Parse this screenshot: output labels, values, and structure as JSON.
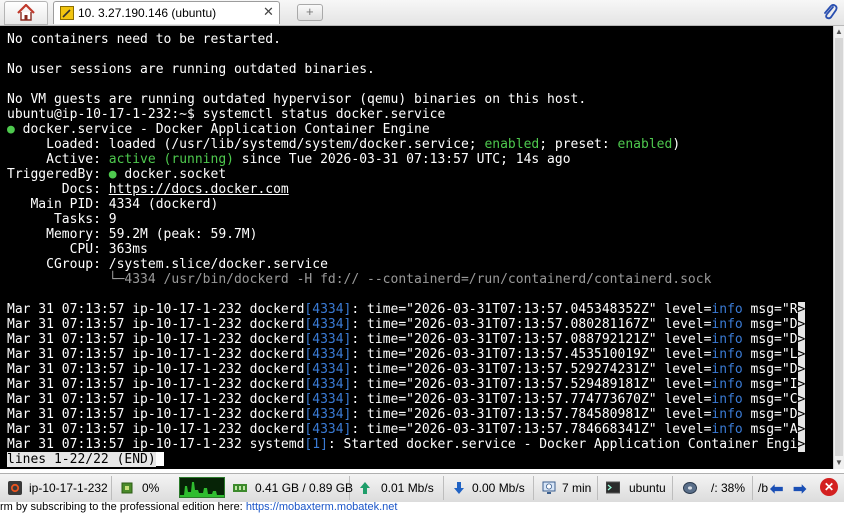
{
  "tabs": {
    "home_icon": "home-icon",
    "session_title": "10. 3.27.190.146 (ubuntu)",
    "close_glyph": "✕",
    "new_tab_glyph": "+"
  },
  "terminal": {
    "lines": [
      "No containers need to be restarted.",
      "",
      "No user sessions are running outdated binaries.",
      "",
      "No VM guests are running outdated hypervisor (qemu) binaries on this host.",
      "ubuntu@ip-10-17-1-232:~$ systemctl status docker.service",
      "● docker.service - Docker Application Container Engine",
      "     Loaded: loaded (/usr/lib/systemd/system/docker.service; enabled; preset: enabled)",
      "     Active: active (running) since Tue 2026-03-31 07:13:57 UTC; 14s ago",
      "TriggeredBy: ● docker.socket",
      "       Docs: https://docs.docker.com",
      "   Main PID: 4334 (dockerd)",
      "      Tasks: 9",
      "     Memory: 59.2M (peak: 59.7M)",
      "        CPU: 363ms",
      "     CGroup: /system.slice/docker.service",
      "             └─4334 /usr/bin/dockerd -H fd:// --containerd=/run/containerd/containerd.sock",
      ""
    ],
    "log": {
      "prefix": "Mar 31 07:13:57 ip-10-17-1-232 ",
      "entries": [
        {
          "proc": "dockerd",
          "pid": "[4334]",
          "time": "2026-03-31T07:13:57.045348352Z",
          "msg": "R"
        },
        {
          "proc": "dockerd",
          "pid": "[4334]",
          "time": "2026-03-31T07:13:57.080281167Z",
          "msg": "D"
        },
        {
          "proc": "dockerd",
          "pid": "[4334]",
          "time": "2026-03-31T07:13:57.088792121Z",
          "msg": "D"
        },
        {
          "proc": "dockerd",
          "pid": "[4334]",
          "time": "2026-03-31T07:13:57.453510019Z",
          "msg": "L"
        },
        {
          "proc": "dockerd",
          "pid": "[4334]",
          "time": "2026-03-31T07:13:57.529274231Z",
          "msg": "D"
        },
        {
          "proc": "dockerd",
          "pid": "[4334]",
          "time": "2026-03-31T07:13:57.529489181Z",
          "msg": "I"
        },
        {
          "proc": "dockerd",
          "pid": "[4334]",
          "time": "2026-03-31T07:13:57.774773670Z",
          "msg": "C"
        },
        {
          "proc": "dockerd",
          "pid": "[4334]",
          "time": "2026-03-31T07:13:57.784580981Z",
          "msg": "D"
        },
        {
          "proc": "dockerd",
          "pid": "[4334]",
          "time": "2026-03-31T07:13:57.784668341Z",
          "msg": "A"
        }
      ],
      "last_line": {
        "proc": "systemd",
        "pid": "[1]",
        "text": ": Started docker.service - Docker Application Container Engi",
        "trunc": ">"
      },
      "level": "info"
    },
    "pager_status": "lines 1-22/22 (END)"
  },
  "statusbar": {
    "host": "ip-10-17-1-232",
    "cpu": "0%",
    "memory": "0.41 GB / 0.89 GB",
    "upload": "0.01 Mb/s",
    "download": "0.00 Mb/s",
    "uptime": "7 min",
    "user": "ubuntu",
    "disk": "/: 38%",
    "disk2": "/b"
  },
  "footer": {
    "text": "rm by subscribing to the professional edition here:",
    "link": "https://mobaxterm.mobatek.net"
  },
  "colors": {
    "terminal_bg": "#000000",
    "green": "#4ec94e",
    "blue": "#3a7bd5"
  }
}
